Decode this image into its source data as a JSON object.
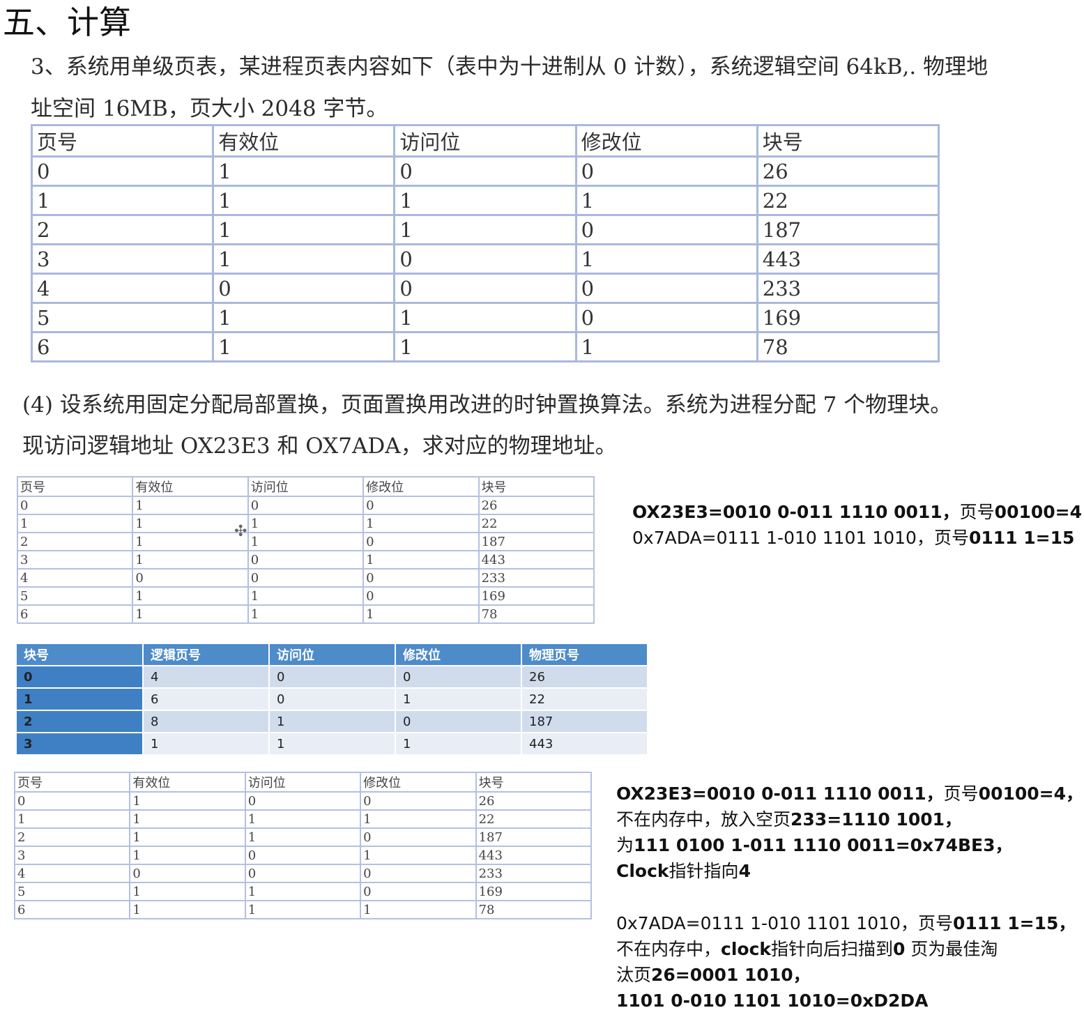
{
  "heading": "五、计算",
  "problem": {
    "line1": "3、系统用单级页表，某进程页表内容如下（表中为十进制从 0 计数），系统逻辑空间 64kB,. 物理地",
    "line2": "址空间 16MB，页大小 2048 字节。"
  },
  "page_table": {
    "headers": [
      "页号",
      "有效位",
      "访问位",
      "修改位",
      "块号"
    ],
    "rows": [
      [
        "0",
        "1",
        "0",
        "0",
        "26"
      ],
      [
        "1",
        "1",
        "1",
        "1",
        "22"
      ],
      [
        "2",
        "1",
        "1",
        "0",
        "187"
      ],
      [
        "3",
        "1",
        "0",
        "1",
        "443"
      ],
      [
        "4",
        "0",
        "0",
        "0",
        "233"
      ],
      [
        "5",
        "1",
        "1",
        "0",
        "169"
      ],
      [
        "6",
        "1",
        "1",
        "1",
        "78"
      ]
    ]
  },
  "question": {
    "line1": "(4) 设系统用固定分配局部置换，页面置换用改进的时钟置换算法。系统为进程分配 7 个物理块。",
    "line2": "现访问逻辑地址 OX23E3 和 OX7ADA，求对应的物理地址。"
  },
  "memory_table": {
    "headers": [
      "块号",
      "逻辑页号",
      "访问位",
      "修改位",
      "物理页号"
    ],
    "rows": [
      [
        "0",
        "4",
        "0",
        "0",
        "26"
      ],
      [
        "1",
        "6",
        "0",
        "1",
        "22"
      ],
      [
        "2",
        "8",
        "1",
        "0",
        "187"
      ],
      [
        "3",
        "1",
        "1",
        "1",
        "443"
      ]
    ]
  },
  "note1": {
    "line1_a": "OX23E3=0010 0-011 1110 0011，",
    "line1_b": "页号",
    "line1_c": "00100=4",
    "line2_a": "0x7ADA=0111 1-010 1101 1010，",
    "line2_b": "页号",
    "line2_c": "0111 1=15"
  },
  "note2": {
    "a1": "OX23E3=0010 0-011 1110 0011，",
    "a2": "页号",
    "a3": "00100=4，",
    "b1": "不在内存中，放入空页",
    "b2": "233=1110 1001，",
    "c1": "为",
    "c2": "111 0100 1-011 1110 0011=0x74BE3，",
    "d1": "Clock",
    "d2": "指针指向",
    "d3": "4",
    "e1": "0x7ADA=0111 1-010 1101 1010，",
    "e2": "页号",
    "e3": "0111 1=15，",
    "f1": "不在内存中，",
    "f2": "clock",
    "f3": "指针向后扫描到",
    "f4": "0",
    "f5": " 页为最佳淘",
    "g1": "汰页",
    "g2": "26=0001 1010，",
    "h1": "1101 0-010 1101 1010=0xD2DA"
  }
}
